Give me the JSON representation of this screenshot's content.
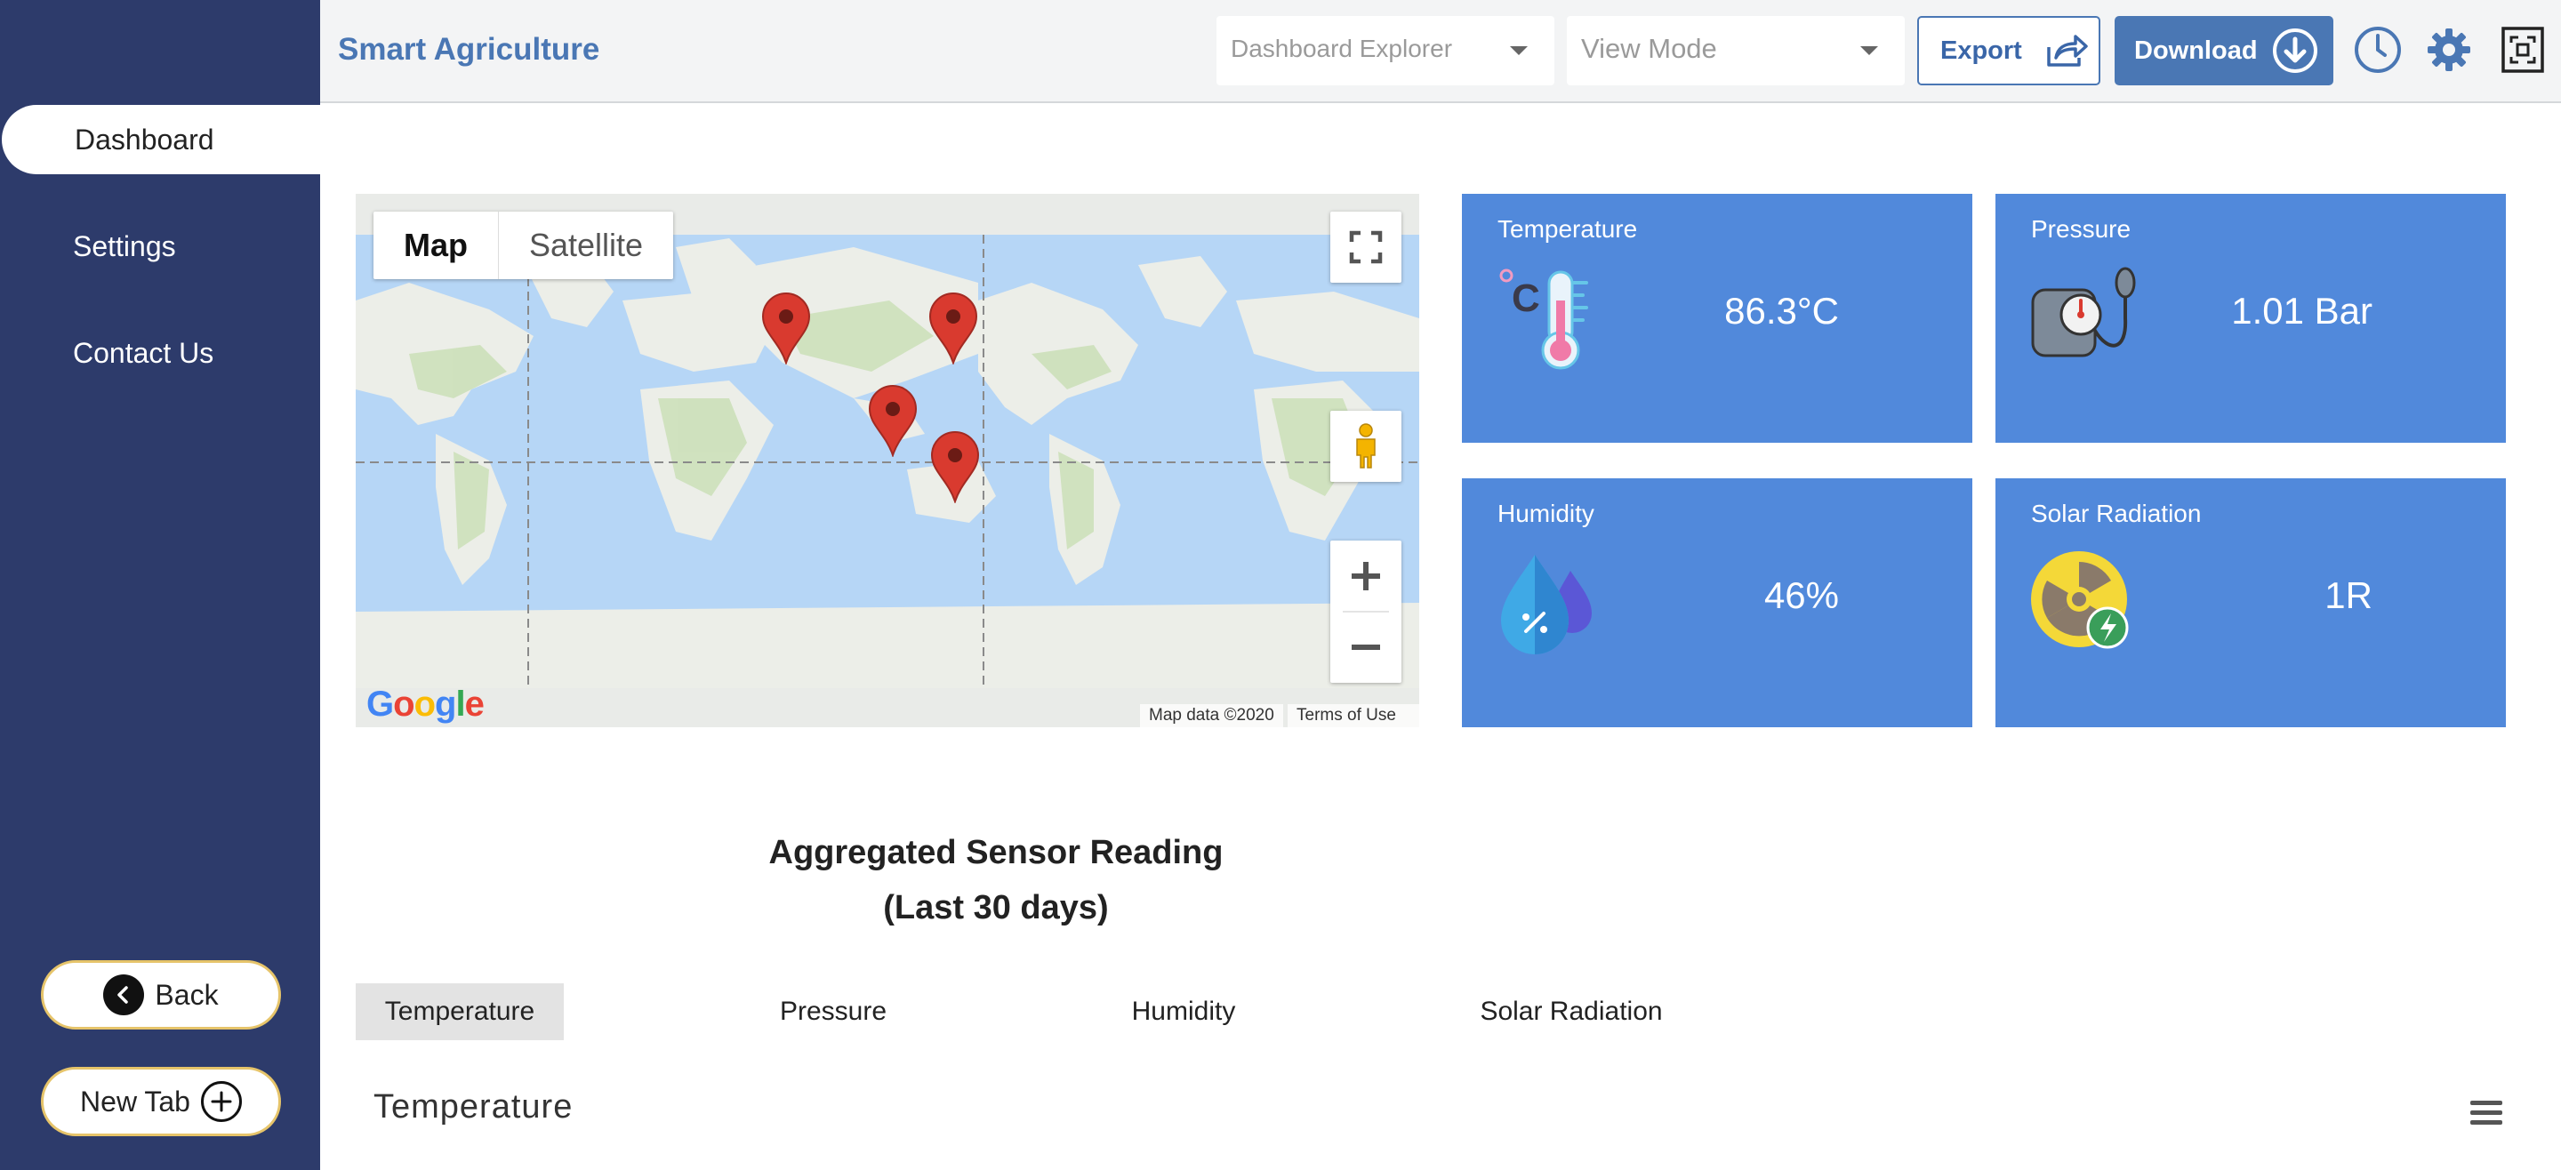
{
  "header": {
    "title": "Smart Agriculture",
    "explorer_select": "Dashboard Explorer",
    "view_mode_select": "View Mode",
    "export_label": "Export",
    "download_label": "Download"
  },
  "sidebar": {
    "items": [
      {
        "label": "Dashboard",
        "active": true
      },
      {
        "label": "Settings",
        "active": false
      },
      {
        "label": "Contact Us",
        "active": false
      }
    ],
    "back_label": "Back",
    "new_tab_label": "New Tab"
  },
  "map": {
    "type_map": "Map",
    "type_satellite": "Satellite",
    "attribution": "Map data ©2020",
    "terms": "Terms of Use",
    "logo": "Google"
  },
  "sensors": [
    {
      "label": "Temperature",
      "value": "86.3°C",
      "icon": "thermometer-icon"
    },
    {
      "label": "Pressure",
      "value": "1.01 Bar",
      "icon": "pressure-gauge-icon"
    },
    {
      "label": "Humidity",
      "value": "46%",
      "icon": "humidity-drop-icon"
    },
    {
      "label": "Solar Radiation",
      "value": "1R",
      "icon": "radiation-icon"
    }
  ],
  "aggregated": {
    "title_line1": "Aggregated Sensor Reading",
    "title_line2": "(Last 30 days)",
    "tabs": [
      "Temperature",
      "Pressure",
      "Humidity",
      "Solar Radiation"
    ],
    "active_tab": "Temperature",
    "chart_title": "Temperature"
  },
  "colors": {
    "sidebar": "#2d3b6b",
    "accent": "#4a77b4",
    "card": "#5189db",
    "button_border": "#e6c46a"
  }
}
